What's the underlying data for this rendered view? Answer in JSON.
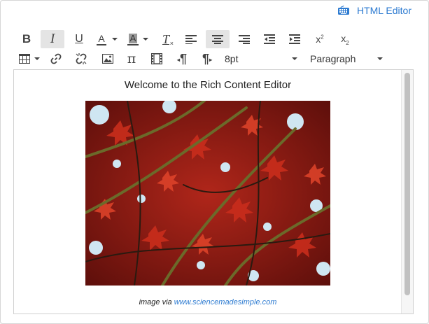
{
  "header": {
    "html_editor_label": "HTML Editor"
  },
  "toolbar": {
    "font_size": "8pt",
    "block_format": "Paragraph",
    "bold_glyph": "B",
    "italic_glyph": "I",
    "underline_glyph": "U",
    "text_color_glyph": "A",
    "background_color_glyph": "A",
    "clear_format_glyph": "T",
    "pi_glyph": "π",
    "ltr_glyph": "¶",
    "rtl_glyph": "¶"
  },
  "content": {
    "title": "Welcome to the Rich Content Editor",
    "caption_prefix": "image via",
    "caption_link": "www.sciencemadesimple.com"
  },
  "colors": {
    "accent": "#2d7bd1",
    "photo_base": "#8a1a12"
  }
}
